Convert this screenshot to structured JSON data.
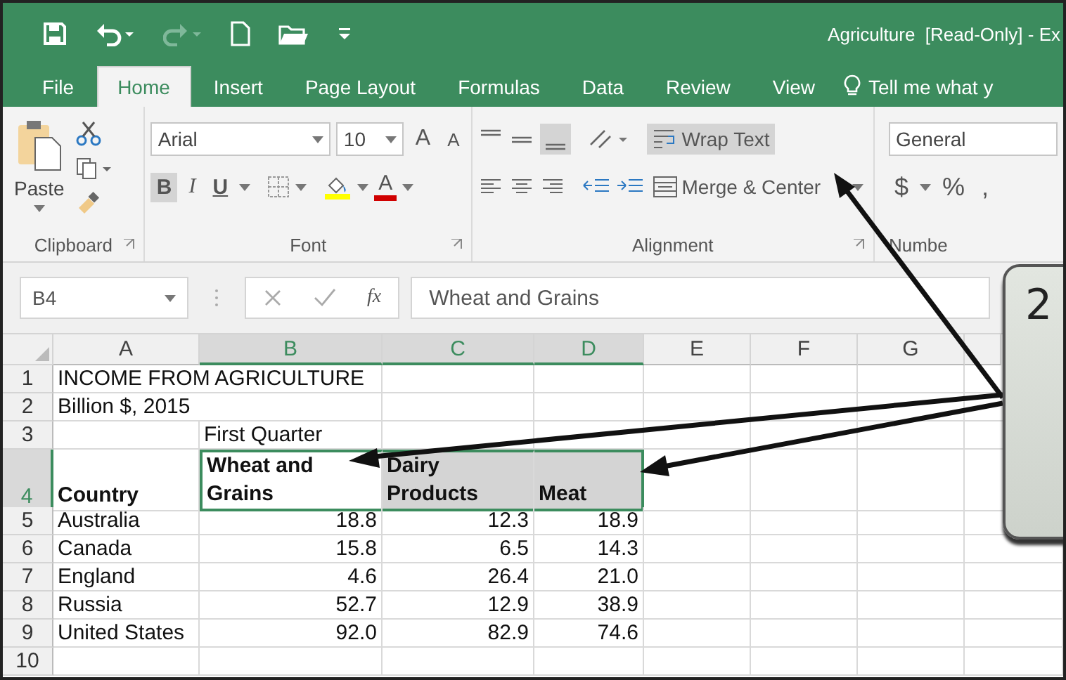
{
  "title_bar": {
    "title": "Agriculture  [Read-Only] - Ex"
  },
  "tabs": [
    {
      "label": "File",
      "selected": false
    },
    {
      "label": "Home",
      "selected": true
    },
    {
      "label": "Insert",
      "selected": false
    },
    {
      "label": "Page Layout",
      "selected": false
    },
    {
      "label": "Formulas",
      "selected": false
    },
    {
      "label": "Data",
      "selected": false
    },
    {
      "label": "Review",
      "selected": false
    },
    {
      "label": "View",
      "selected": false
    }
  ],
  "tell_me": {
    "placeholder": "Tell me what y"
  },
  "ribbon": {
    "clipboard": {
      "label": "Clipboard",
      "paste": "Paste"
    },
    "font": {
      "label": "Font",
      "name": "Arial",
      "size": "10",
      "grow": "A",
      "shrink": "A",
      "bold": {
        "label": "B",
        "active": true
      },
      "italic": {
        "label": "I",
        "active": false
      },
      "underline": {
        "label": "U",
        "active": false
      },
      "font_color": "A"
    },
    "alignment": {
      "label": "Alignment",
      "bottom_align_active": true,
      "wrap_text": {
        "label": "Wrap Text",
        "active": true
      },
      "merge": "Merge & Center"
    },
    "number": {
      "label": "Numbe",
      "format": "General",
      "currency": "$",
      "percent": "%",
      "comma": ","
    }
  },
  "formula_bar": {
    "name_box": "B4",
    "function_label": "fx",
    "value": "Wheat and Grains"
  },
  "sheet": {
    "columns": [
      {
        "label": "A",
        "selected": false
      },
      {
        "label": "B",
        "selected": true
      },
      {
        "label": "C",
        "selected": true
      },
      {
        "label": "D",
        "selected": true
      },
      {
        "label": "E",
        "selected": false
      },
      {
        "label": "F",
        "selected": false
      },
      {
        "label": "G",
        "selected": false
      }
    ],
    "rows": [
      {
        "number": "1",
        "kind": "title",
        "selected": false,
        "cells": [
          {
            "text": "INCOME FROM AGRICULTURE"
          }
        ]
      },
      {
        "number": "2",
        "kind": "title",
        "selected": false,
        "cells": [
          {
            "text": "Billion $, 2015"
          }
        ]
      },
      {
        "number": "3",
        "kind": "text",
        "selected": false,
        "cells": [
          null,
          {
            "text": "First Quarter"
          }
        ]
      },
      {
        "number": "4",
        "kind": "header",
        "selected": true,
        "cells": [
          {
            "text": "Country",
            "selected": false
          },
          {
            "text": "Wheat and Grains",
            "selected": true,
            "active": true
          },
          {
            "text": "Dairy Products",
            "selected": true
          },
          {
            "text": "Meat",
            "selected": true
          }
        ]
      },
      {
        "number": "5",
        "kind": "data",
        "selected": false,
        "cells": [
          {
            "text": "Australia"
          },
          {
            "text": "18.8"
          },
          {
            "text": "12.3"
          },
          {
            "text": "18.9"
          }
        ]
      },
      {
        "number": "6",
        "kind": "data",
        "selected": false,
        "cells": [
          {
            "text": "Canada"
          },
          {
            "text": "15.8"
          },
          {
            "text": "6.5"
          },
          {
            "text": "14.3"
          }
        ]
      },
      {
        "number": "7",
        "kind": "data",
        "selected": false,
        "cells": [
          {
            "text": "England"
          },
          {
            "text": "4.6"
          },
          {
            "text": "26.4"
          },
          {
            "text": "21.0"
          }
        ]
      },
      {
        "number": "8",
        "kind": "data",
        "selected": false,
        "cells": [
          {
            "text": "Russia"
          },
          {
            "text": "52.7"
          },
          {
            "text": "12.9"
          },
          {
            "text": "38.9"
          }
        ]
      },
      {
        "number": "9",
        "kind": "data",
        "selected": false,
        "cells": [
          {
            "text": "United States"
          },
          {
            "text": "92.0"
          },
          {
            "text": "82.9"
          },
          {
            "text": "74.6"
          }
        ]
      },
      {
        "number": "10",
        "kind": "data",
        "selected": false,
        "cells": []
      }
    ]
  },
  "callout": {
    "label": "2"
  }
}
